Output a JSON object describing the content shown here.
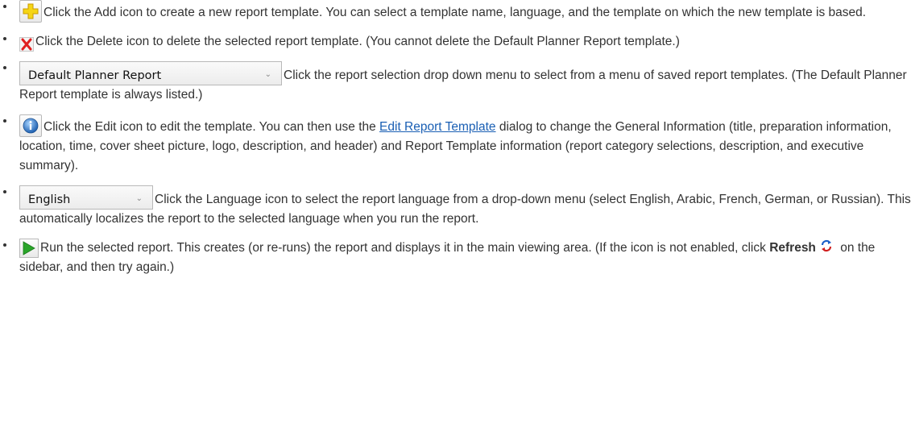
{
  "items": [
    {
      "icon": "add-icon",
      "text": "Click the Add icon to create a new report template. You can select a template name, language, and the template on which the new template is based."
    },
    {
      "icon": "delete-icon",
      "text": "Click the Delete icon to delete the selected report template. (You cannot delete the Default Planner Report template.)"
    },
    {
      "icon": "chevron-down-icon",
      "dropdown_value": "Default Planner Report",
      "text": "Click the report selection drop down menu to select from a menu of saved report templates. (The Default Planner Report template is always listed.)"
    },
    {
      "icon": "info-icon",
      "text_before": "Click the Edit icon to edit the template. You can then use the ",
      "link": "Edit Report Template",
      "text_after": " dialog to change the General Information (title, preparation information, location, time, cover sheet picture, logo, description, and header) and Report Template information (report category selections, description, and executive summary)."
    },
    {
      "icon": "chevron-down-icon",
      "dropdown_value": "English",
      "text": "Click the Language icon to select the report language from a drop-down menu (select English, Arabic, French, German, or Russian). This automatically localizes the report to the selected language when you run the report."
    },
    {
      "icon": "play-icon",
      "text_before": "Run the selected report. This creates (or re-runs) the report and displays it in the main viewing area. (If the icon is not enabled, click ",
      "bold": "Refresh",
      "refresh_icon": "refresh-icon",
      "text_after": " on the sidebar, and then try again.)"
    }
  ],
  "colors": {
    "text": "#333333",
    "link": "#1a5fb4",
    "add_icon_fill": "#f5d515",
    "delete_icon": "#e02020",
    "run_icon": "#2aa52a"
  }
}
